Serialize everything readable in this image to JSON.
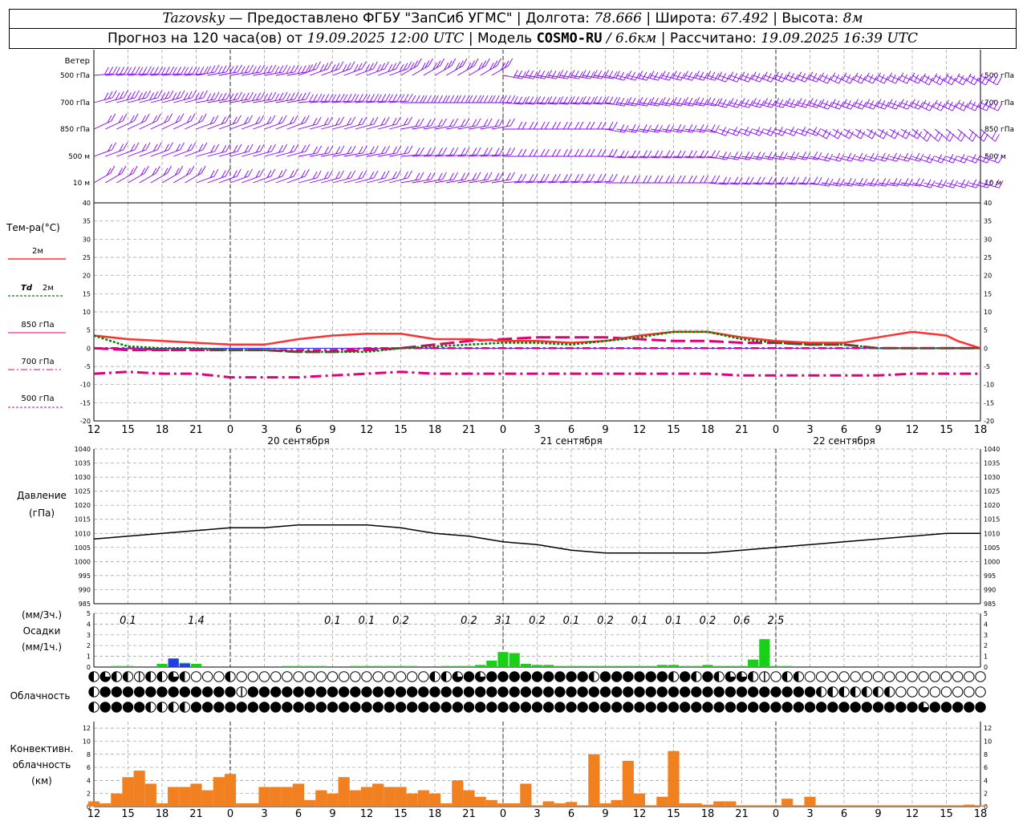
{
  "header": {
    "station": "Tazovsky",
    "provider": "— Предоставлено ФГБУ \"ЗапСиб УГМС\" |",
    "lon_label": "Долгота:",
    "lon_value": "78.666",
    "lat_label": "| Широта:",
    "lat_value": "67.492",
    "alt_label": "| Высота:",
    "alt_value": "8м",
    "forecast_label": "Прогноз на 120 часа(ов) от",
    "forecast_start": "19.09.2025 12:00 UTC",
    "model_label": "| Модель",
    "model_name": "COSMO-RU",
    "model_res": "/ 6.6км",
    "calc_label": "| Рассчитано:",
    "calc_time": "19.09.2025 16:39 UTC"
  },
  "x_axis": {
    "hour_labels": [
      "12",
      "15",
      "18",
      "21",
      "0",
      "3",
      "6",
      "9",
      "12",
      "15",
      "18",
      "21",
      "0",
      "3",
      "6",
      "9",
      "12",
      "15",
      "18",
      "21",
      "0",
      "3",
      "6",
      "9",
      "12",
      "15",
      "18"
    ],
    "day_labels": [
      {
        "text": "20 сентября",
        "hour": 18
      },
      {
        "text": "21 сентября",
        "hour": 42
      },
      {
        "text": "22 сентября",
        "hour": 66
      }
    ],
    "midnights": [
      12,
      36,
      60
    ]
  },
  "wind": {
    "title": "Ветер",
    "levels": [
      "500 гПа",
      "700 гПа",
      "850 гПа",
      "500 м",
      "10 м"
    ],
    "color": "#8000ff"
  },
  "temperature": {
    "title": "Тем-ра(°C)",
    "ylim": [
      -20,
      40
    ],
    "ticks": [
      "40",
      "35",
      "30",
      "25",
      "20",
      "15",
      "10",
      "5",
      "0",
      "-5",
      "-10",
      "-15",
      "-20"
    ],
    "legend": {
      "t2m": "2м",
      "td_italic": "Td",
      "td_rest": "2м",
      "t850": "850 гПа",
      "t700": "700 гПа",
      "t500": "500 гПа"
    },
    "colors": {
      "t2m": "#ff3030",
      "td2m": "#008000",
      "t850": "#e0007a",
      "t700": "#e0007a",
      "t500": "#e0007a"
    }
  },
  "pressure": {
    "title1": "Давление",
    "title2": "(гПа)",
    "ylim": [
      985,
      1040
    ],
    "ticks": [
      "1040",
      "1035",
      "1030",
      "1025",
      "1020",
      "1015",
      "1010",
      "1005",
      "1000",
      "995",
      "990",
      "985"
    ]
  },
  "precip": {
    "title1": "(мм/3ч.)",
    "title2": "Осадки",
    "title3": "(мм/1ч.)",
    "ticks": [
      "5",
      "4",
      "3",
      "2",
      "1",
      "0"
    ],
    "totals": [
      {
        "hour": 3,
        "text": "0.1"
      },
      {
        "hour": 9,
        "text": "1.4"
      },
      {
        "hour": 21,
        "text": "0.1"
      },
      {
        "hour": 24,
        "text": "0.1"
      },
      {
        "hour": 27,
        "text": "0.2"
      },
      {
        "hour": 33,
        "text": "0.2"
      },
      {
        "hour": 36,
        "text": "3.1"
      },
      {
        "hour": 39,
        "text": "0.2"
      },
      {
        "hour": 42,
        "text": "0.1"
      },
      {
        "hour": 45,
        "text": "0.2"
      },
      {
        "hour": 48,
        "text": "0.1"
      },
      {
        "hour": 51,
        "text": "0.1"
      },
      {
        "hour": 54,
        "text": "0.2"
      },
      {
        "hour": 57,
        "text": "0.6"
      },
      {
        "hour": 60,
        "text": "2.5"
      }
    ]
  },
  "clouds": {
    "title": "Облачность"
  },
  "convective": {
    "title1": "Конвективн.",
    "title2": "облачность",
    "title3": "(км)",
    "ticks": [
      "12",
      "10",
      "8",
      "6",
      "4",
      "2",
      "0"
    ],
    "color": "#f08020"
  },
  "chart_data": {
    "type": "line",
    "time_axis": "hours since 19.09.2025 12:00 UTC, hourly 0–78",
    "t2m": [
      [
        0,
        3.5
      ],
      [
        3,
        2.5
      ],
      [
        6,
        2
      ],
      [
        9,
        1.5
      ],
      [
        12,
        1
      ],
      [
        15,
        1
      ],
      [
        18,
        2.5
      ],
      [
        21,
        3.5
      ],
      [
        24,
        4
      ],
      [
        27,
        4
      ],
      [
        30,
        2.5
      ],
      [
        33,
        2.5
      ],
      [
        36,
        2
      ],
      [
        39,
        2
      ],
      [
        42,
        1.5
      ],
      [
        45,
        2
      ],
      [
        48,
        3.5
      ],
      [
        51,
        4.5
      ],
      [
        54,
        4.5
      ],
      [
        57,
        3
      ],
      [
        60,
        2
      ],
      [
        63,
        1.5
      ],
      [
        66,
        1.5
      ],
      [
        69,
        3
      ],
      [
        72,
        4.5
      ],
      [
        75,
        3.5
      ],
      [
        76,
        2
      ],
      [
        78,
        0
      ]
    ],
    "td2m": [
      [
        0,
        3.5
      ],
      [
        3,
        0.5
      ],
      [
        6,
        0
      ],
      [
        9,
        0
      ],
      [
        12,
        -0.5
      ],
      [
        15,
        -0.5
      ],
      [
        18,
        -1
      ],
      [
        21,
        -1
      ],
      [
        24,
        -1
      ],
      [
        27,
        0
      ],
      [
        30,
        0.5
      ],
      [
        33,
        1
      ],
      [
        36,
        1.5
      ],
      [
        39,
        1.5
      ],
      [
        42,
        1
      ],
      [
        45,
        2
      ],
      [
        48,
        3
      ],
      [
        51,
        4.5
      ],
      [
        54,
        4.5
      ],
      [
        57,
        2.5
      ],
      [
        60,
        1.5
      ],
      [
        63,
        1
      ],
      [
        66,
        1
      ],
      [
        69,
        0
      ],
      [
        72,
        0
      ],
      [
        75,
        0
      ],
      [
        78,
        0
      ]
    ],
    "t850": [
      [
        0,
        0
      ],
      [
        3,
        -0.5
      ],
      [
        6,
        -0.5
      ],
      [
        9,
        -0.5
      ],
      [
        12,
        -0.5
      ],
      [
        15,
        -0.5
      ],
      [
        18,
        -1
      ],
      [
        21,
        -1
      ],
      [
        24,
        -0.5
      ],
      [
        27,
        0
      ],
      [
        30,
        1
      ],
      [
        33,
        2
      ],
      [
        36,
        2.5
      ],
      [
        39,
        3
      ],
      [
        42,
        3
      ],
      [
        45,
        3
      ],
      [
        48,
        2.5
      ],
      [
        51,
        2
      ],
      [
        54,
        2
      ],
      [
        57,
        1.5
      ],
      [
        60,
        1.5
      ],
      [
        63,
        1
      ],
      [
        66,
        1
      ],
      [
        69,
        0
      ],
      [
        72,
        0
      ],
      [
        75,
        0
      ],
      [
        78,
        0
      ]
    ],
    "t700": [
      [
        0,
        0
      ],
      [
        3,
        0
      ],
      [
        6,
        -0.5
      ],
      [
        9,
        -0.5
      ],
      [
        12,
        -0.5
      ],
      [
        15,
        -0.5
      ],
      [
        18,
        -0.5
      ],
      [
        21,
        -0.5
      ],
      [
        24,
        0
      ],
      [
        27,
        0
      ],
      [
        30,
        0
      ],
      [
        33,
        0
      ],
      [
        36,
        0
      ],
      [
        39,
        0
      ],
      [
        42,
        0
      ],
      [
        45,
        0
      ],
      [
        48,
        0
      ],
      [
        51,
        0
      ],
      [
        54,
        0
      ],
      [
        57,
        0
      ],
      [
        60,
        0
      ],
      [
        63,
        0
      ],
      [
        66,
        0
      ],
      [
        69,
        0
      ],
      [
        72,
        0
      ],
      [
        75,
        0
      ],
      [
        78,
        0
      ]
    ],
    "t500": [
      [
        0,
        -7
      ],
      [
        3,
        -6.5
      ],
      [
        6,
        -7
      ],
      [
        9,
        -7
      ],
      [
        12,
        -8
      ],
      [
        15,
        -8
      ],
      [
        18,
        -8
      ],
      [
        21,
        -7.5
      ],
      [
        24,
        -7
      ],
      [
        27,
        -6.5
      ],
      [
        30,
        -7
      ],
      [
        33,
        -7
      ],
      [
        36,
        -7
      ],
      [
        39,
        -7
      ],
      [
        42,
        -7
      ],
      [
        45,
        -7
      ],
      [
        48,
        -7
      ],
      [
        51,
        -7
      ],
      [
        54,
        -7
      ],
      [
        57,
        -7.5
      ],
      [
        60,
        -7.5
      ],
      [
        63,
        -7.5
      ],
      [
        66,
        -7.5
      ],
      [
        69,
        -7.5
      ],
      [
        72,
        -7
      ],
      [
        75,
        -7
      ],
      [
        78,
        -7
      ]
    ],
    "pressure": [
      [
        0,
        1008
      ],
      [
        3,
        1009
      ],
      [
        6,
        1010
      ],
      [
        9,
        1011
      ],
      [
        12,
        1012
      ],
      [
        15,
        1012
      ],
      [
        18,
        1013
      ],
      [
        21,
        1013
      ],
      [
        24,
        1013
      ],
      [
        27,
        1012
      ],
      [
        30,
        1010
      ],
      [
        33,
        1009
      ],
      [
        36,
        1007
      ],
      [
        39,
        1006
      ],
      [
        42,
        1004
      ],
      [
        45,
        1003
      ],
      [
        48,
        1003
      ],
      [
        51,
        1003
      ],
      [
        54,
        1003
      ],
      [
        57,
        1004
      ],
      [
        60,
        1005
      ],
      [
        63,
        1006
      ],
      [
        66,
        1007
      ],
      [
        69,
        1008
      ],
      [
        72,
        1009
      ],
      [
        75,
        1010
      ],
      [
        78,
        1010
      ]
    ],
    "precip_liquid": [
      [
        2,
        0.1
      ],
      [
        3,
        0.1
      ],
      [
        6,
        0.3
      ],
      [
        7,
        0.7
      ],
      [
        8,
        0.4
      ],
      [
        9,
        0.3
      ],
      [
        17,
        0.1
      ],
      [
        18,
        0.1
      ],
      [
        19,
        0.1
      ],
      [
        20,
        0.1
      ],
      [
        23,
        0.1
      ],
      [
        24,
        0.1
      ],
      [
        25,
        0.1
      ],
      [
        26,
        0.1
      ],
      [
        27,
        0.1
      ],
      [
        28,
        0.1
      ],
      [
        31,
        0.1
      ],
      [
        32,
        0.1
      ],
      [
        33,
        0.1
      ],
      [
        34,
        0.2
      ],
      [
        35,
        0.6
      ],
      [
        36,
        1.4
      ],
      [
        37,
        1.3
      ],
      [
        38,
        0.3
      ],
      [
        39,
        0.2
      ],
      [
        40,
        0.2
      ],
      [
        41,
        0.1
      ],
      [
        42,
        0.1
      ],
      [
        43,
        0.1
      ],
      [
        44,
        0.1
      ],
      [
        45,
        0.1
      ],
      [
        46,
        0.1
      ],
      [
        47,
        0.1
      ],
      [
        48,
        0.1
      ],
      [
        49,
        0.1
      ],
      [
        50,
        0.2
      ],
      [
        51,
        0.2
      ],
      [
        52,
        0.1
      ],
      [
        53,
        0.1
      ],
      [
        54,
        0.2
      ],
      [
        55,
        0.1
      ],
      [
        56,
        0.1
      ],
      [
        57,
        0.1
      ],
      [
        58,
        0.7
      ],
      [
        59,
        2.6
      ],
      [
        60,
        0.1
      ],
      [
        61,
        0.1
      ]
    ],
    "precip_snow": [
      [
        7,
        0.8
      ],
      [
        8,
        0.3
      ]
    ],
    "cloud_rows": [
      [
        2,
        3,
        2,
        2,
        1,
        2,
        2,
        3,
        2,
        0,
        0,
        0,
        2,
        0,
        0,
        0,
        0,
        0,
        0,
        0,
        0,
        0,
        0,
        0,
        0,
        0,
        0,
        0,
        0,
        0,
        2,
        2,
        3,
        4,
        3,
        4,
        4,
        4,
        4,
        4,
        4,
        4,
        4,
        4,
        2,
        4,
        4,
        4,
        4,
        4,
        4,
        2,
        4,
        2,
        4,
        2,
        3,
        3,
        2,
        1,
        0,
        2,
        2,
        0,
        0,
        0,
        0,
        0,
        0,
        0,
        0,
        0,
        0,
        0,
        0,
        0,
        0,
        0,
        0
      ],
      [
        2,
        4,
        4,
        4,
        4,
        4,
        4,
        4,
        4,
        4,
        4,
        4,
        4,
        1,
        4,
        4,
        4,
        4,
        4,
        4,
        4,
        4,
        4,
        4,
        4,
        4,
        4,
        4,
        4,
        4,
        4,
        4,
        4,
        4,
        4,
        4,
        4,
        4,
        4,
        4,
        4,
        4,
        4,
        4,
        4,
        4,
        4,
        4,
        4,
        4,
        4,
        4,
        4,
        4,
        4,
        4,
        4,
        4,
        4,
        4,
        4,
        4,
        4,
        4,
        2,
        2,
        2,
        2,
        2,
        2,
        2,
        0,
        0,
        0,
        0,
        0,
        0,
        0,
        0
      ],
      [
        2,
        4,
        4,
        4,
        4,
        2,
        2,
        2,
        2,
        4,
        4,
        4,
        4,
        4,
        4,
        4,
        4,
        4,
        4,
        4,
        4,
        4,
        4,
        4,
        4,
        4,
        4,
        4,
        4,
        4,
        4,
        4,
        4,
        4,
        4,
        4,
        4,
        4,
        4,
        4,
        4,
        4,
        4,
        4,
        4,
        4,
        4,
        4,
        4,
        4,
        4,
        4,
        4,
        4,
        4,
        4,
        4,
        4,
        4,
        4,
        4,
        4,
        4,
        4,
        4,
        4,
        4,
        4,
        4,
        4,
        4,
        4,
        4,
        3,
        4,
        4,
        4,
        4,
        4
      ]
    ],
    "convective_cloud": [
      [
        0,
        0.8
      ],
      [
        1,
        0.5
      ],
      [
        2,
        2
      ],
      [
        3,
        4.5
      ],
      [
        4,
        5.5
      ],
      [
        5,
        3.5
      ],
      [
        6,
        0.5
      ],
      [
        7,
        3
      ],
      [
        8,
        3
      ],
      [
        9,
        3.5
      ],
      [
        10,
        2.5
      ],
      [
        11,
        4.5
      ],
      [
        12,
        5
      ],
      [
        13,
        0.5
      ],
      [
        14,
        0.5
      ],
      [
        15,
        3
      ],
      [
        16,
        3
      ],
      [
        17,
        3
      ],
      [
        18,
        3.5
      ],
      [
        19,
        1
      ],
      [
        20,
        2.5
      ],
      [
        21,
        2
      ],
      [
        22,
        4.5
      ],
      [
        23,
        2.5
      ],
      [
        24,
        3
      ],
      [
        25,
        3.5
      ],
      [
        26,
        3
      ],
      [
        27,
        3
      ],
      [
        28,
        2
      ],
      [
        29,
        2.5
      ],
      [
        30,
        2
      ],
      [
        31,
        0.5
      ],
      [
        32,
        4
      ],
      [
        33,
        2.5
      ],
      [
        34,
        1.5
      ],
      [
        35,
        1
      ],
      [
        36,
        0.5
      ],
      [
        37,
        0.5
      ],
      [
        38,
        3.5
      ],
      [
        39,
        0.2
      ],
      [
        40,
        0.8
      ],
      [
        41,
        0.5
      ],
      [
        42,
        0.7
      ],
      [
        43,
        0.2
      ],
      [
        44,
        8
      ],
      [
        45,
        0.5
      ],
      [
        46,
        1
      ],
      [
        47,
        7
      ],
      [
        48,
        2
      ],
      [
        49,
        0.2
      ],
      [
        50,
        1.5
      ],
      [
        51,
        8.5
      ],
      [
        52,
        0.5
      ],
      [
        53,
        0.5
      ],
      [
        54,
        0.3
      ],
      [
        55,
        0.8
      ],
      [
        56,
        0.8
      ],
      [
        57,
        0.2
      ],
      [
        58,
        0.2
      ],
      [
        59,
        0.2
      ],
      [
        60,
        0.2
      ],
      [
        61,
        1.2
      ],
      [
        62,
        0.2
      ],
      [
        63,
        1.5
      ],
      [
        64,
        0.2
      ],
      [
        65,
        0.2
      ],
      [
        66,
        0.2
      ],
      [
        67,
        0.2
      ],
      [
        68,
        0.2
      ],
      [
        69,
        0.2
      ],
      [
        70,
        0.2
      ],
      [
        71,
        0.2
      ],
      [
        72,
        0.2
      ],
      [
        73,
        0.2
      ],
      [
        74,
        0.2
      ],
      [
        75,
        0.2
      ],
      [
        76,
        0.2
      ],
      [
        77,
        0.3
      ],
      [
        78,
        0.2
      ]
    ]
  }
}
